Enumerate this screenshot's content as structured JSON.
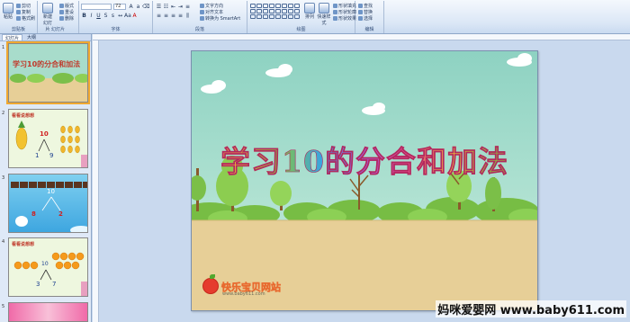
{
  "ribbon": {
    "groups": [
      "剪贴板",
      "幻灯片",
      "字体",
      "段落",
      "绘图",
      "编辑"
    ],
    "clipboard": {
      "paste": "粘贴",
      "cut": "剪切",
      "copy": "复制",
      "format_painter": "格式刷"
    },
    "slides": {
      "new_slide": "新建幻灯片",
      "layout": "版式",
      "reset": "重设",
      "delete": "删除"
    },
    "font": {
      "name": "",
      "size": "72"
    },
    "paragraph": {
      "text_direction": "文字方向",
      "align_text": "对齐文本",
      "smartart": "转换为 SmartArt"
    },
    "drawing": {
      "arrange": "排列",
      "quick_styles": "快速样式",
      "shape_fill": "形状填充",
      "shape_outline": "形状轮廓",
      "shape_effects": "形状效果"
    },
    "editing": {
      "find": "查找",
      "replace": "替换",
      "select": "选择"
    }
  },
  "panel": {
    "tabs": [
      "幻灯片",
      "大纲"
    ]
  },
  "thumbnails": [
    {
      "num": "1",
      "title": "学习10的分合和加法"
    },
    {
      "num": "2",
      "title": "看看说想想",
      "top": "10",
      "left": "1",
      "right": "9"
    },
    {
      "num": "3",
      "top": "10",
      "left": "8",
      "right": "2"
    },
    {
      "num": "4",
      "title": "看看说想想",
      "top": "10",
      "left": "3",
      "right": "7"
    },
    {
      "num": "5"
    }
  ],
  "slide": {
    "title": "学习10的分合和加法",
    "logo_text": "快乐宝贝网站",
    "logo_url": "www.baby611.com"
  },
  "watermark": "妈咪爱婴网 www.baby611.com",
  "colors": {
    "sky": "#a8dccb",
    "ground": "#e7cf97",
    "title_stroke": "#b2285f"
  }
}
